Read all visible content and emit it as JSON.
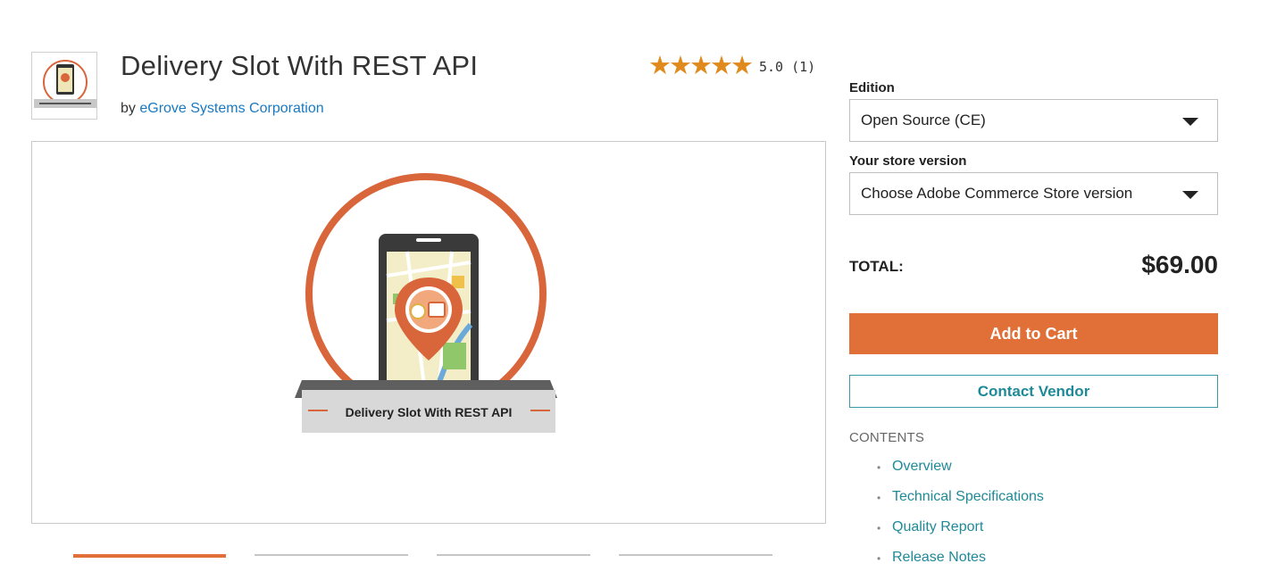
{
  "product": {
    "title": "Delivery Slot With REST API",
    "by_prefix": "by ",
    "vendor": "eGrove Systems Corporation",
    "rating_text": "5.0 (1)",
    "stars": 5,
    "image_caption": "Delivery Slot With REST API"
  },
  "purchase": {
    "edition_label": "Edition",
    "edition_value": "Open Source (CE)",
    "version_label": "Your store version",
    "version_value": "Choose Adobe Commerce Store version",
    "total_label": "TOTAL:",
    "total_value": "$69.00",
    "add_to_cart": "Add to Cart",
    "contact_vendor": "Contact Vendor"
  },
  "contents": {
    "label": "CONTENTS",
    "items": [
      "Overview",
      "Technical Specifications",
      "Quality Report",
      "Release Notes"
    ]
  },
  "colors": {
    "accent": "#e07037",
    "link": "#1f8a97",
    "star": "#e08a1e"
  }
}
